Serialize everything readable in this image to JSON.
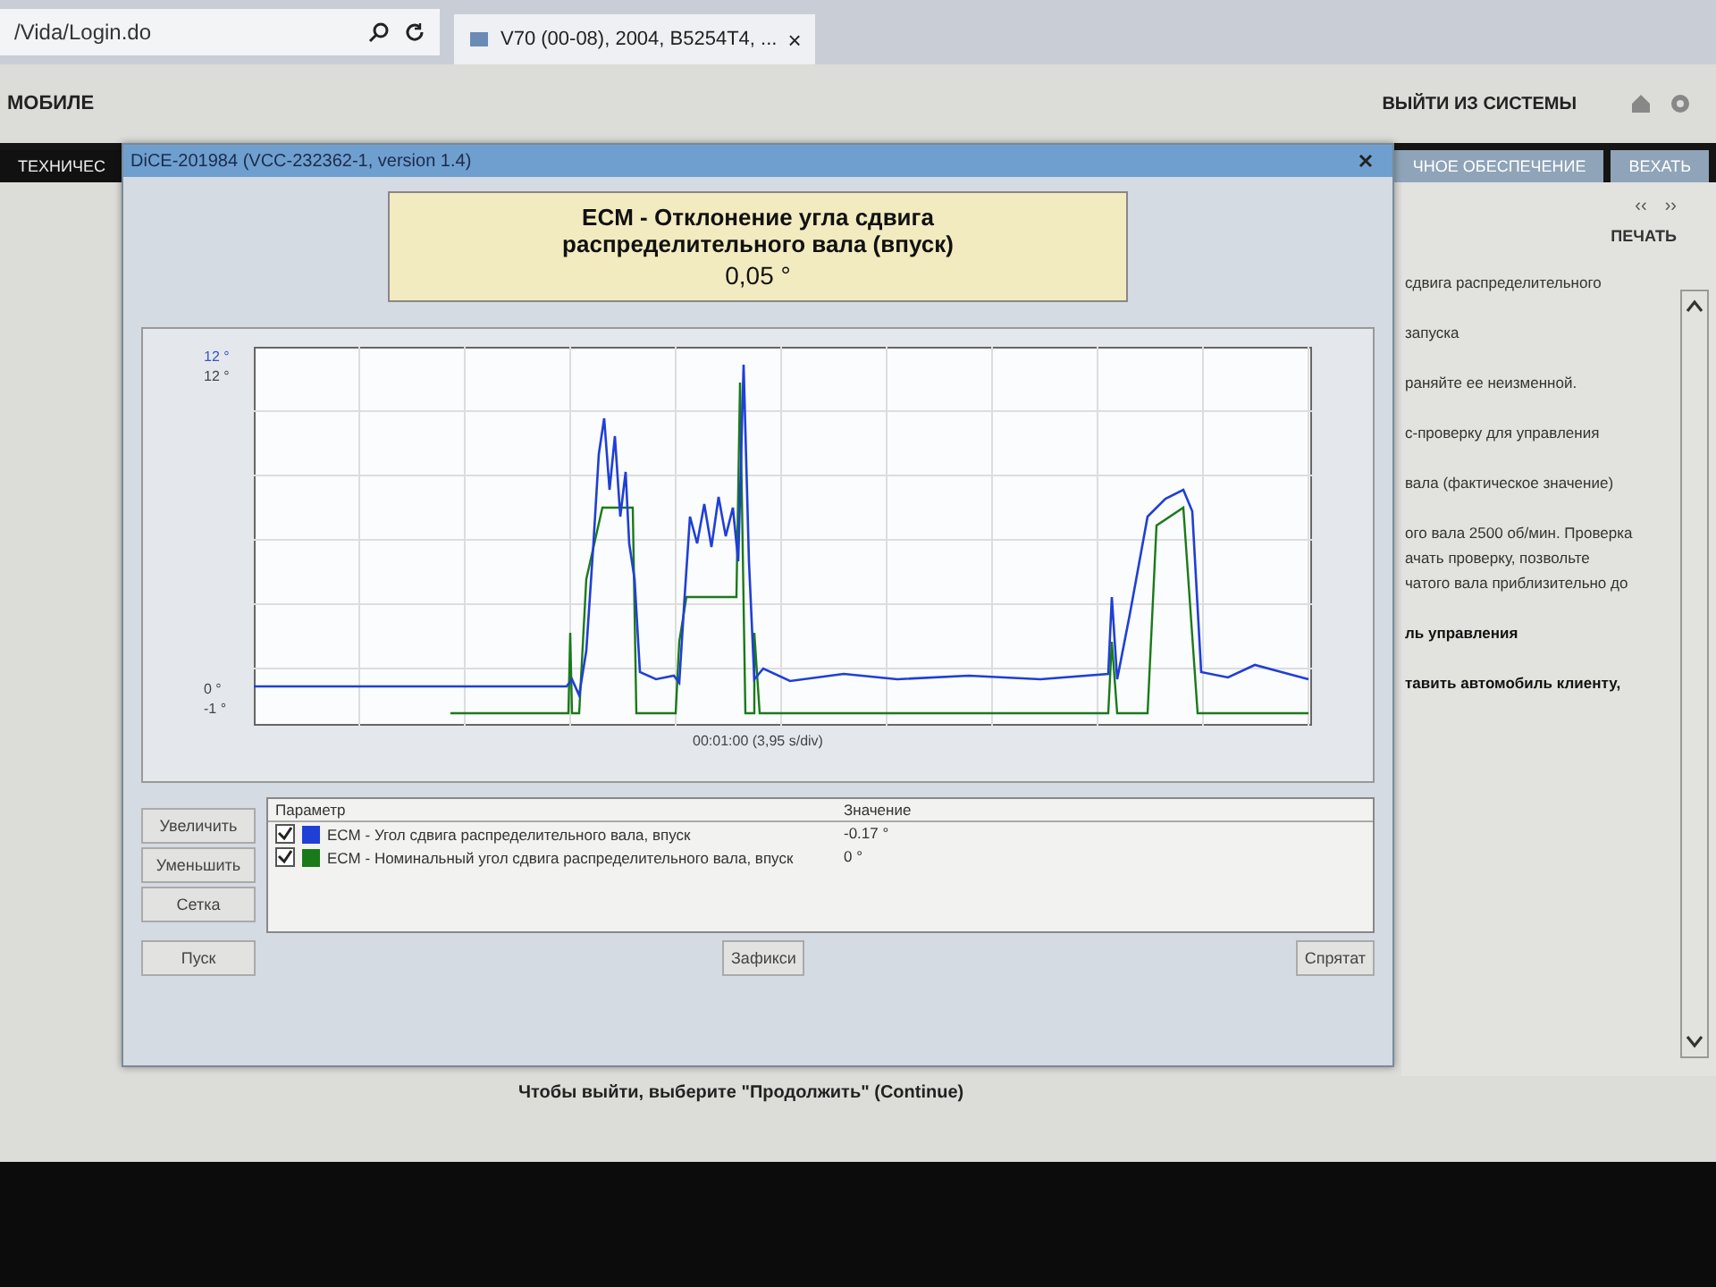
{
  "browser": {
    "address": "/Vida/Login.do",
    "tab": {
      "title": "V70 (00-08), 2004, B5254T4, ...",
      "close": "×"
    }
  },
  "header": {
    "title": "МОБИЛЕ",
    "logout": "ВЫЙТИ ИЗ СИСТЕМЫ"
  },
  "nav": {
    "tabs": [
      {
        "label": "ТЕХНИЧЕС",
        "selected": true
      },
      {
        "label": "ЧНОЕ ОБЕСПЕЧЕНИЕ",
        "selected": false
      },
      {
        "label": "ВЕХАТЬ",
        "selected": false
      }
    ]
  },
  "side_panel": {
    "nav": [
      "‹‹",
      "››"
    ],
    "print": "ПЕЧАТЬ",
    "lines": [
      {
        "text": "сдвига распределительного",
        "bold": false
      },
      {
        "text": "запуска",
        "bold": false
      },
      {
        "text": "раняйте ее неизменной.",
        "bold": false
      },
      {
        "text": "с-проверку для управления",
        "bold": false
      },
      {
        "text": "вала (фактическое значение)",
        "bold": false
      },
      {
        "text": "ого вала 2500 об/мин. Проверка",
        "bold": false
      },
      {
        "text": "ачать проверку, позвольте",
        "bold": false
      },
      {
        "text": "чатого вала приблизительно до",
        "bold": false
      },
      {
        "text": "ль управления",
        "bold": true
      },
      {
        "text": "тавить автомобиль клиенту,",
        "bold": true
      }
    ]
  },
  "footer_text": "Чтобы выйти, выберите \"Продолжить\" (Continue)",
  "dialog": {
    "title": "DiCE-201984   (VCC-232362-1, version 1.4)",
    "reading": {
      "title": "ECM - Отклонение угла сдвига распределительного вала (впуск)",
      "value": "0,05 °"
    },
    "chart": {
      "y_labels": [
        {
          "text": "12 °",
          "color": "#3355cc"
        },
        {
          "text": "12 °",
          "color": "#444444"
        },
        {
          "text": "0 °",
          "color": "#444444"
        },
        {
          "text": "-1 °",
          "color": "#444444"
        }
      ],
      "x_label": "00:01:00 (3,95 s/div)"
    },
    "table": {
      "columns": [
        "Параметр",
        "Значение"
      ],
      "rows": [
        {
          "checked": true,
          "color": "#1f3fd6",
          "name": "ECM - Угол сдвига распределительного вала, впуск",
          "value": "-0.17 °"
        },
        {
          "checked": true,
          "color": "#1a7a1a",
          "name": "ECM - Номинальный угол сдвига распределительного вала, впуск",
          "value": "0 °"
        }
      ]
    },
    "side_buttons": [
      "Увеличить",
      "Уменьшить",
      "Сетка"
    ],
    "start_button": "Пуск",
    "fix_button": "Зафикси",
    "hide_button": "Спрятат"
  }
}
